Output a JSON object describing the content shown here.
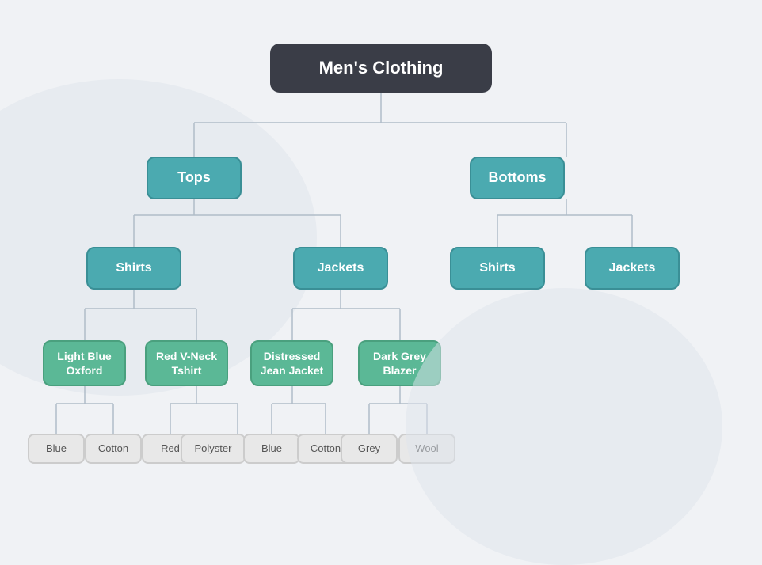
{
  "root": {
    "label": "Men's Clothing"
  },
  "level1": {
    "tops": "Tops",
    "bottoms": "Bottoms"
  },
  "level2": {
    "shirts_tops": "Shirts",
    "jackets_tops": "Jackets",
    "shirts_bottoms": "Shirts",
    "jackets_bottoms": "Jackets"
  },
  "level3": {
    "lightblue": "Light Blue Oxford",
    "redvneck": "Red V-Neck Tshirt",
    "distressed": "Distressed Jean Jacket",
    "darkgrey": "Dark Grey Blazer"
  },
  "level4": {
    "blue1": "Blue",
    "cotton1": "Cotton",
    "red1": "Red",
    "polyster": "Polyster",
    "blue2": "Blue",
    "cotton2": "Cotton",
    "grey": "Grey",
    "wool": "Wool"
  },
  "colors": {
    "root_bg": "#3a3d47",
    "teal": "#4baab0",
    "green": "#5bb896",
    "grey_attr": "#e8e8e8"
  }
}
